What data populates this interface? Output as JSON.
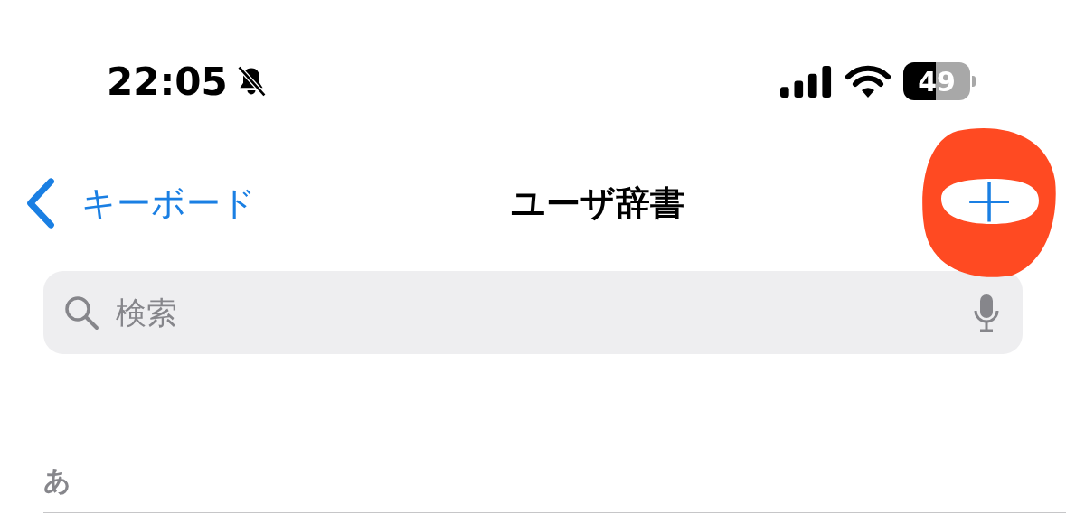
{
  "status_bar": {
    "time": "22:05",
    "battery": "49"
  },
  "nav": {
    "back_label": "キーボード",
    "title": "ユーザ辞書",
    "add_button": "+"
  },
  "search": {
    "placeholder": "検索"
  },
  "sections": [
    {
      "header": "あ"
    }
  ]
}
